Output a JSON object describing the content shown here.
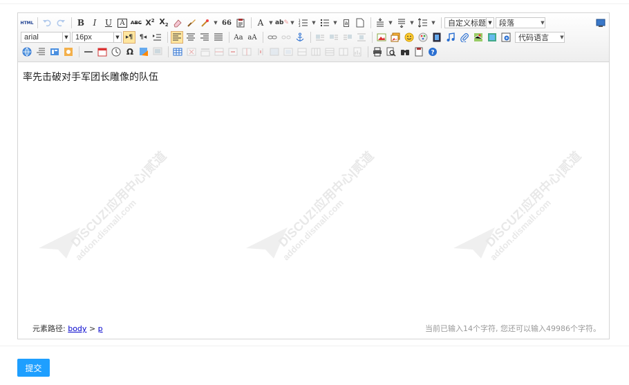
{
  "toolbar": {
    "html_label": "HTML",
    "quote_label": "66",
    "custom_title": "自定义标题",
    "paragraph": "段落",
    "font_family": "arial",
    "font_size": "16px",
    "code_language": "代码语言"
  },
  "content": {
    "text": "率先击破对手军团长雕像的队伍"
  },
  "watermark": {
    "line1": "DISCUZ!应用中心|贰道",
    "line2": "addon.dismall.com"
  },
  "status": {
    "path_label": "元素路径:",
    "path_body": "body",
    "path_sep": ">",
    "path_p": "p",
    "char_count": "当前已输入14个字符, 您还可以输入49986个字符。"
  },
  "submit_label": "提交",
  "colors": {
    "accent": "#1e9fff",
    "selected": "#ffe69f"
  }
}
